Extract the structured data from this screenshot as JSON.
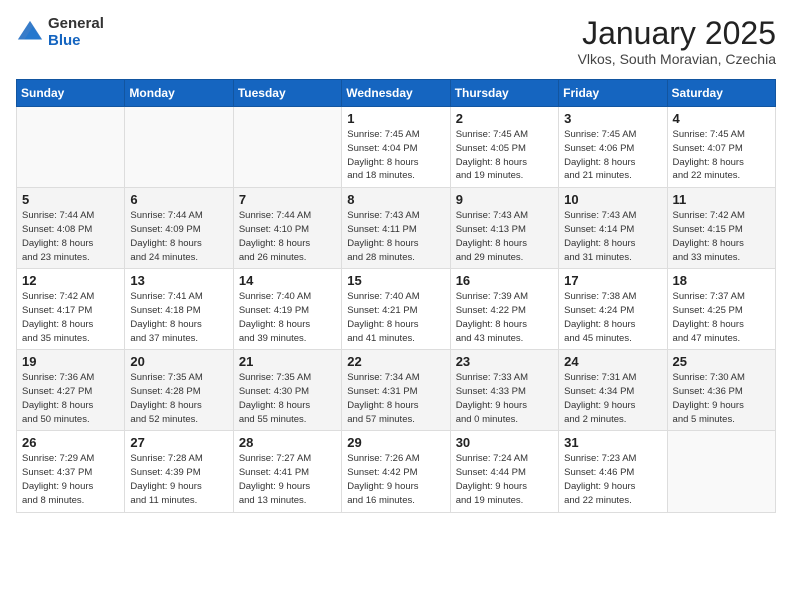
{
  "logo": {
    "general": "General",
    "blue": "Blue"
  },
  "header": {
    "month_year": "January 2025",
    "location": "Vlkos, South Moravian, Czechia"
  },
  "weekdays": [
    "Sunday",
    "Monday",
    "Tuesday",
    "Wednesday",
    "Thursday",
    "Friday",
    "Saturday"
  ],
  "weeks": [
    [
      {
        "day": "",
        "info": ""
      },
      {
        "day": "",
        "info": ""
      },
      {
        "day": "",
        "info": ""
      },
      {
        "day": "1",
        "info": "Sunrise: 7:45 AM\nSunset: 4:04 PM\nDaylight: 8 hours\nand 18 minutes."
      },
      {
        "day": "2",
        "info": "Sunrise: 7:45 AM\nSunset: 4:05 PM\nDaylight: 8 hours\nand 19 minutes."
      },
      {
        "day": "3",
        "info": "Sunrise: 7:45 AM\nSunset: 4:06 PM\nDaylight: 8 hours\nand 21 minutes."
      },
      {
        "day": "4",
        "info": "Sunrise: 7:45 AM\nSunset: 4:07 PM\nDaylight: 8 hours\nand 22 minutes."
      }
    ],
    [
      {
        "day": "5",
        "info": "Sunrise: 7:44 AM\nSunset: 4:08 PM\nDaylight: 8 hours\nand 23 minutes."
      },
      {
        "day": "6",
        "info": "Sunrise: 7:44 AM\nSunset: 4:09 PM\nDaylight: 8 hours\nand 24 minutes."
      },
      {
        "day": "7",
        "info": "Sunrise: 7:44 AM\nSunset: 4:10 PM\nDaylight: 8 hours\nand 26 minutes."
      },
      {
        "day": "8",
        "info": "Sunrise: 7:43 AM\nSunset: 4:11 PM\nDaylight: 8 hours\nand 28 minutes."
      },
      {
        "day": "9",
        "info": "Sunrise: 7:43 AM\nSunset: 4:13 PM\nDaylight: 8 hours\nand 29 minutes."
      },
      {
        "day": "10",
        "info": "Sunrise: 7:43 AM\nSunset: 4:14 PM\nDaylight: 8 hours\nand 31 minutes."
      },
      {
        "day": "11",
        "info": "Sunrise: 7:42 AM\nSunset: 4:15 PM\nDaylight: 8 hours\nand 33 minutes."
      }
    ],
    [
      {
        "day": "12",
        "info": "Sunrise: 7:42 AM\nSunset: 4:17 PM\nDaylight: 8 hours\nand 35 minutes."
      },
      {
        "day": "13",
        "info": "Sunrise: 7:41 AM\nSunset: 4:18 PM\nDaylight: 8 hours\nand 37 minutes."
      },
      {
        "day": "14",
        "info": "Sunrise: 7:40 AM\nSunset: 4:19 PM\nDaylight: 8 hours\nand 39 minutes."
      },
      {
        "day": "15",
        "info": "Sunrise: 7:40 AM\nSunset: 4:21 PM\nDaylight: 8 hours\nand 41 minutes."
      },
      {
        "day": "16",
        "info": "Sunrise: 7:39 AM\nSunset: 4:22 PM\nDaylight: 8 hours\nand 43 minutes."
      },
      {
        "day": "17",
        "info": "Sunrise: 7:38 AM\nSunset: 4:24 PM\nDaylight: 8 hours\nand 45 minutes."
      },
      {
        "day": "18",
        "info": "Sunrise: 7:37 AM\nSunset: 4:25 PM\nDaylight: 8 hours\nand 47 minutes."
      }
    ],
    [
      {
        "day": "19",
        "info": "Sunrise: 7:36 AM\nSunset: 4:27 PM\nDaylight: 8 hours\nand 50 minutes."
      },
      {
        "day": "20",
        "info": "Sunrise: 7:35 AM\nSunset: 4:28 PM\nDaylight: 8 hours\nand 52 minutes."
      },
      {
        "day": "21",
        "info": "Sunrise: 7:35 AM\nSunset: 4:30 PM\nDaylight: 8 hours\nand 55 minutes."
      },
      {
        "day": "22",
        "info": "Sunrise: 7:34 AM\nSunset: 4:31 PM\nDaylight: 8 hours\nand 57 minutes."
      },
      {
        "day": "23",
        "info": "Sunrise: 7:33 AM\nSunset: 4:33 PM\nDaylight: 9 hours\nand 0 minutes."
      },
      {
        "day": "24",
        "info": "Sunrise: 7:31 AM\nSunset: 4:34 PM\nDaylight: 9 hours\nand 2 minutes."
      },
      {
        "day": "25",
        "info": "Sunrise: 7:30 AM\nSunset: 4:36 PM\nDaylight: 9 hours\nand 5 minutes."
      }
    ],
    [
      {
        "day": "26",
        "info": "Sunrise: 7:29 AM\nSunset: 4:37 PM\nDaylight: 9 hours\nand 8 minutes."
      },
      {
        "day": "27",
        "info": "Sunrise: 7:28 AM\nSunset: 4:39 PM\nDaylight: 9 hours\nand 11 minutes."
      },
      {
        "day": "28",
        "info": "Sunrise: 7:27 AM\nSunset: 4:41 PM\nDaylight: 9 hours\nand 13 minutes."
      },
      {
        "day": "29",
        "info": "Sunrise: 7:26 AM\nSunset: 4:42 PM\nDaylight: 9 hours\nand 16 minutes."
      },
      {
        "day": "30",
        "info": "Sunrise: 7:24 AM\nSunset: 4:44 PM\nDaylight: 9 hours\nand 19 minutes."
      },
      {
        "day": "31",
        "info": "Sunrise: 7:23 AM\nSunset: 4:46 PM\nDaylight: 9 hours\nand 22 minutes."
      },
      {
        "day": "",
        "info": ""
      }
    ]
  ]
}
